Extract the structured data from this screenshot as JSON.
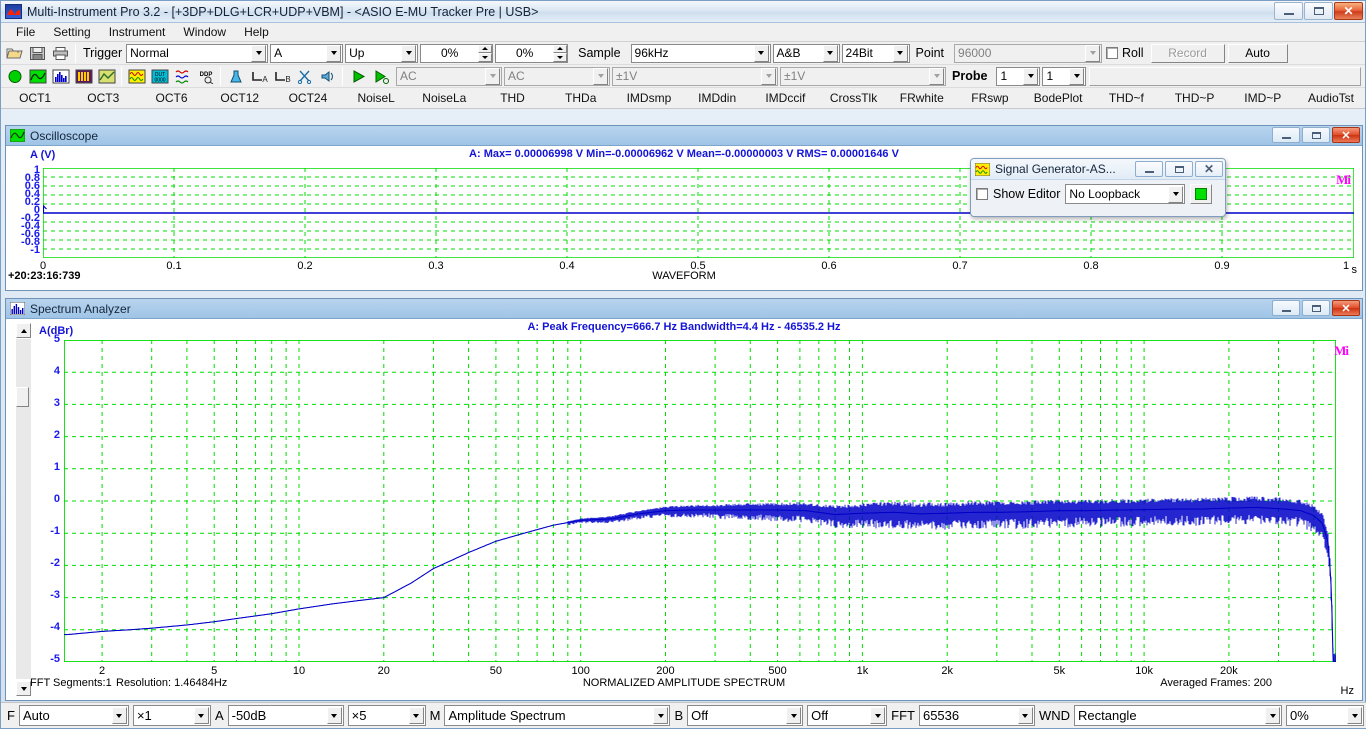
{
  "window": {
    "title": "Multi-Instrument Pro 3.2  -  [+3DP+DLG+LCR+UDP+VBM]  -  <ASIO E-MU Tracker Pre | USB>",
    "minimize": "–",
    "maximize": "❐",
    "close": "✕"
  },
  "menu": [
    "File",
    "Setting",
    "Instrument",
    "Window",
    "Help"
  ],
  "toolbar1": {
    "trigger_label": "Trigger",
    "mode": "Normal",
    "channel": "A",
    "slope": "Up",
    "level": "0%",
    "delay": "0%",
    "sample_label": "Sample",
    "rate": "96kHz",
    "channels": "A&B",
    "bits": "24Bit",
    "point_label": "Point",
    "points": "96000",
    "roll_label": "Roll",
    "record_label": "Record",
    "auto_label": "Auto"
  },
  "toolbar2": {
    "coupling_a": "AC",
    "coupling_b": "AC",
    "range_a": "±1V",
    "range_b": "±1V",
    "probe_label": "Probe",
    "probe_a": "1",
    "probe_b": "1"
  },
  "tabs": [
    "OCT1",
    "OCT3",
    "OCT6",
    "OCT12",
    "OCT24",
    "NoiseL",
    "NoiseLa",
    "THD",
    "THDa",
    "IMDsmp",
    "IMDdin",
    "IMDccif",
    "CrossTlk",
    "FRwhite",
    "FRswp",
    "BodePlot",
    "THD~f",
    "THD~P",
    "IMD~P",
    "AudioTst"
  ],
  "oscilloscope": {
    "title": "Oscilloscope",
    "y_axis_label": "A (V)",
    "readout": "A: Max= 0.00006998 V  Min=-0.00006962 V  Mean=-0.00000003 V  RMS= 0.00001646 V",
    "timestamp": "+20:23:16:739",
    "x_footer": "WAVEFORM",
    "x_unit": "s",
    "watermark": "Mi"
  },
  "signal_generator": {
    "title": "Signal Generator-AS...",
    "show_editor_label": "Show Editor",
    "loopback": "No Loopback"
  },
  "spectrum": {
    "title": "Spectrum Analyzer",
    "y_axis_label": "A(dBr)",
    "readout": "A: Peak Frequency=666.7 Hz  Bandwidth=4.4 Hz - 46535.2 Hz",
    "segments": "FFT Segments:1",
    "resolution": "Resolution: 1.46484Hz",
    "x_footer": "NORMALIZED AMPLITUDE SPECTRUM",
    "avg_frames": "Averaged Frames: 200",
    "x_unit": "Hz",
    "watermark": "Mi"
  },
  "statusbar": {
    "f_label": "F",
    "f_mode": "Auto",
    "f_zoom": "×1",
    "a_label": "A",
    "a_ref": "-50dB",
    "a_zoom": "×5",
    "m_label": "M",
    "m_mode": "Amplitude Spectrum",
    "b_label": "B",
    "b_mode": "Off",
    "b_aux": "Off",
    "fft_label": "FFT",
    "fft_size": "65536",
    "wnd_label": "WND",
    "window": "Rectangle",
    "overlap": "0%"
  },
  "chart_data": [
    {
      "type": "line",
      "title": "WAVEFORM",
      "name": "oscilloscope",
      "xlabel": "s",
      "ylabel": "A (V)",
      "xlim": [
        0,
        1
      ],
      "ylim": [
        -1,
        1
      ],
      "xticks": [
        "0",
        "0.1",
        "0.2",
        "0.3",
        "0.4",
        "0.5",
        "0.6",
        "0.7",
        "0.8",
        "0.9",
        "1"
      ],
      "yticks": [
        "1",
        "0.8",
        "0.6",
        "0.4",
        "0.2",
        "0",
        "-0.2",
        "-0.4",
        "-0.6",
        "-0.8",
        "-1"
      ],
      "grid": true,
      "series": [
        {
          "name": "A",
          "color": "#0000c8",
          "description": "flat trace at 0 V (amplitude ~0.00007 V, not visible at ±1 V scale)",
          "values": [
            0,
            0
          ]
        }
      ],
      "annotations": [
        "A: Max= 0.00006998 V",
        "Min=-0.00006962 V",
        "Mean=-0.00000003 V",
        "RMS= 0.00001646 V"
      ]
    },
    {
      "type": "line",
      "title": "NORMALIZED AMPLITUDE SPECTRUM",
      "name": "spectrum-analyzer",
      "xlabel": "Hz",
      "ylabel": "A(dBr)",
      "xscale": "log",
      "xlim": [
        1.46484,
        48000
      ],
      "ylim": [
        -5,
        5
      ],
      "xticks": [
        "2",
        "5",
        "10",
        "20",
        "50",
        "100",
        "200",
        "500",
        "1k",
        "2k",
        "5k",
        "10k",
        "20k"
      ],
      "yticks": [
        "5",
        "4",
        "3",
        "2",
        "1",
        "0",
        "-1",
        "-2",
        "-3",
        "-4",
        "-5"
      ],
      "grid": true,
      "legend": "none",
      "series": [
        {
          "name": "A",
          "color": "#0000c8",
          "x": [
            1.5,
            2,
            2.5,
            3,
            4,
            5,
            6,
            8,
            10,
            13,
            16,
            20,
            25,
            30,
            40,
            50,
            63,
            80,
            100,
            130,
            160,
            200,
            250,
            315,
            400,
            500,
            630,
            800,
            1000,
            1300,
            1600,
            2000,
            2500,
            3150,
            4000,
            5000,
            6300,
            8000,
            10000,
            13000,
            16000,
            20000,
            25000,
            31500,
            36000,
            40000,
            43000,
            45000,
            46000,
            46500,
            46600,
            47000
          ],
          "y": [
            -4.15,
            -4.05,
            -4.0,
            -3.95,
            -3.85,
            -3.75,
            -3.65,
            -3.5,
            -3.35,
            -3.2,
            -3.1,
            -3.0,
            -2.55,
            -2.1,
            -1.6,
            -1.25,
            -1.0,
            -0.75,
            -0.6,
            -0.55,
            -0.4,
            -0.3,
            -0.28,
            -0.28,
            -0.28,
            -0.28,
            -0.3,
            -0.42,
            -0.38,
            -0.35,
            -0.4,
            -0.38,
            -0.35,
            -0.35,
            -0.33,
            -0.3,
            -0.3,
            -0.28,
            -0.27,
            -0.25,
            -0.25,
            -0.22,
            -0.2,
            -0.25,
            -0.3,
            -0.45,
            -0.7,
            -1.3,
            -2.4,
            -3.6,
            -4.6,
            -5.0
          ]
        }
      ],
      "annotations": [
        "A: Peak Frequency=666.7 Hz",
        "Bandwidth=4.4 Hz - 46535.2 Hz",
        "FFT Segments:1",
        "Resolution: 1.46484Hz",
        "Averaged Frames: 200"
      ]
    }
  ]
}
